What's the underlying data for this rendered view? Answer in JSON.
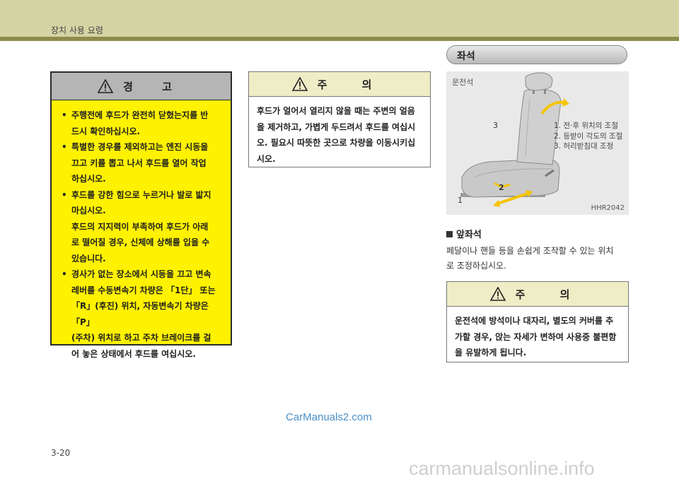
{
  "header": {
    "title": "장치 사용 요령"
  },
  "warning": {
    "title": "경 고",
    "items": [
      {
        "text": "주행전에 후드가 완전히 닫혔는지를 반드시 확인하십시오.",
        "lines": [
          "주행전에 후드가 완전히 닫혔는지를 반",
          "드시 확인하십시오."
        ]
      },
      {
        "text": "특별한 경우를 제외하고는 엔진 시동을 끄고 키를 뽑고 나서 후드를 열어 작업하십시오.",
        "lines": [
          "특별한 경우를 제외하고는 엔진 시동을",
          "끄고 키를 뽑고 나서 후드를 열어 작업",
          "하십시오."
        ]
      },
      {
        "text": "후드를 강한 힘으로 누르거나 발로 밟지 마십시오.",
        "lines": [
          "후드를 강한 힘으로 누르거나 발로 밟지",
          "마십시오."
        ]
      },
      {
        "lines": [
          "후드의 지지력이 부족하여 후드가 아래",
          "로 떨어질 경우, 신체에 상해를 입을 수",
          "있습니다."
        ]
      },
      {
        "text": "경사가 없는 장소에서 시동을 끄고 변속레버를 수동변속기 차량은 「1단」 또는 「R」(후진) 위치, 자동변속기 차량은 「P」(주차) 위치로 하고 주차 브레이크를 걸어 놓은 상태에서 후드를 여십시오.",
        "lines": [
          "경사가 없는 장소에서 시동을 끄고 변속",
          "레버를 수동변속기 차량은 「1단」 또는",
          "「R」(후진) 위치, 자동변속기 차량은 「P」",
          "(주차) 위치로 하고 주차 브레이크를 걸",
          "어 놓은 상태에서 후드를 여십시오."
        ]
      }
    ]
  },
  "caution1": {
    "title": "주 의",
    "lines": [
      "후드가 얼어서 열리지 않을 때는 주변의 얼음",
      "을 제거하고, 가볍게 두드려서 후드를 여십시",
      "오. 필요시 따뜻한 곳으로 차량을 이동시키십",
      "시오."
    ]
  },
  "section": {
    "title": "좌석"
  },
  "figure": {
    "label": "운전석",
    "legend": [
      "1. 전·후 위치의 조절",
      "2. 등받이 각도의 조절",
      "3. 허리받침대 조정"
    ],
    "n1": "1",
    "n2": "2",
    "n3": "3",
    "code": "HHR2042"
  },
  "front_seat": {
    "heading": "앞좌석",
    "lines": [
      "페달이나 핸들 등을 손쉽게 조작할 수 있는 위치",
      "로 조정하십시오."
    ]
  },
  "caution2": {
    "title": "주 의",
    "lines": [
      "운전석에 방석이나 대자리, 별도의 커버를 추",
      "가할 경우, 앉는 자세가 변하여 사용중 불편함",
      "을 유발하게 됩니다."
    ]
  },
  "watermark": "CarManuals2.com",
  "page_number": "3-20",
  "footer_watermark": "carmanualsonline.info",
  "colors": {
    "warning_bg": "#fff200",
    "header_bg": "#d4d3a4",
    "header_line": "#8e8c4c",
    "caution_head": "#efedc6",
    "arrow": "#f5c400"
  }
}
